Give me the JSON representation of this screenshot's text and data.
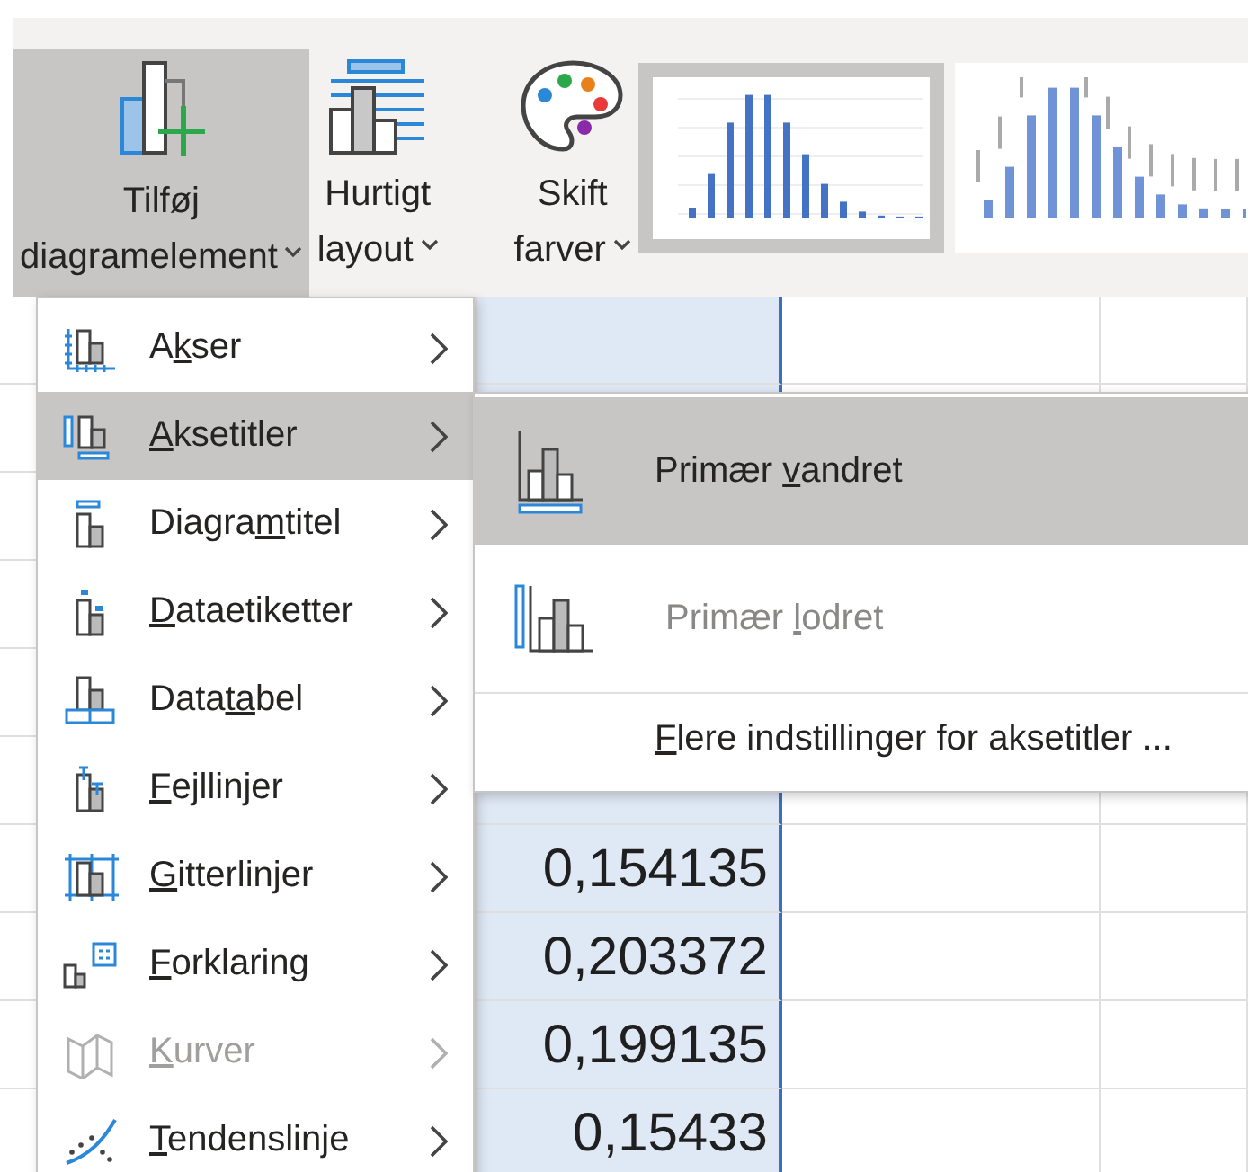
{
  "ribbon": {
    "buttons": [
      {
        "kind": "add-element",
        "lines": [
          "Tilføj",
          "diagramelement"
        ],
        "selected": true
      },
      {
        "kind": "layout",
        "lines": [
          "Hurtigt",
          "layout"
        ],
        "selected": false
      },
      {
        "kind": "colors",
        "lines": [
          "Skift",
          "farver"
        ],
        "selected": false
      }
    ],
    "styles": [
      {
        "selected": true
      },
      {
        "selected": false
      }
    ]
  },
  "menu": {
    "items": [
      {
        "kind": "axes",
        "label": {
          "before": "A",
          "key": "k",
          "after": "ser"
        },
        "selected": false,
        "disabled": false
      },
      {
        "kind": "axis-titles",
        "label": {
          "key": "A",
          "after": "ksetitler"
        },
        "selected": true,
        "disabled": false
      },
      {
        "kind": "chart-title",
        "label": {
          "before": "Diagra",
          "key": "m",
          "after": "titel"
        },
        "selected": false,
        "disabled": false
      },
      {
        "kind": "data-labels",
        "label": {
          "key": "D",
          "after": "ataetiketter"
        },
        "selected": false,
        "disabled": false
      },
      {
        "kind": "data-table",
        "label": {
          "before": "Data",
          "key": "ta",
          "after": "bel"
        },
        "selected": false,
        "disabled": false
      },
      {
        "kind": "error-bars",
        "label": {
          "key": "F",
          "after": "ejllinjer"
        },
        "selected": false,
        "disabled": false
      },
      {
        "kind": "gridlines",
        "label": {
          "key": "G",
          "after": "itterlinjer"
        },
        "selected": false,
        "disabled": false
      },
      {
        "kind": "legend",
        "label": {
          "key": "F",
          "after": "orklaring"
        },
        "selected": false,
        "disabled": false
      },
      {
        "kind": "lines",
        "label": {
          "key": "K",
          "after": "urver"
        },
        "selected": false,
        "disabled": true
      },
      {
        "kind": "trendline",
        "label": {
          "key": "T",
          "after": "endenslinje"
        },
        "selected": false,
        "disabled": false
      }
    ]
  },
  "submenu": {
    "items": [
      {
        "kind": "horizontal",
        "label": {
          "before": "Primær ",
          "key": "v",
          "after": "andret"
        },
        "selected": true,
        "disabled": false
      },
      {
        "kind": "vertical",
        "label": {
          "before": "Primær ",
          "key": "l",
          "after": "odret"
        },
        "selected": false,
        "disabled": true
      },
      {
        "kind": "link",
        "label": {
          "key": "F",
          "after": "lere indstillinger for aksetitler ..."
        },
        "selected": false,
        "disabled": false
      }
    ]
  },
  "sheet": {
    "cells": [
      {
        "value": "0,154135"
      },
      {
        "value": "0,203372"
      },
      {
        "value": "0,199135"
      },
      {
        "value": "0,15433"
      }
    ]
  }
}
